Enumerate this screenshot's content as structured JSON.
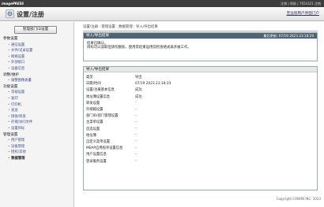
{
  "topbar": {
    "brand": "imagePRESS",
    "meta": "注销 | 帮助 | 7654321 注销"
  },
  "header": {
    "title": "设置/注册",
    "portal": "至远程用户界面门户"
  },
  "sidebar": {
    "button": "管理部门ID设置",
    "nav": [
      {
        "label": "参数设置",
        "type": "cat"
      },
      {
        "label": "通信设置",
        "type": "item"
      },
      {
        "label": "文件/记录设置",
        "type": "item"
      },
      {
        "label": "网络设置",
        "type": "item"
      },
      {
        "label": "外部接口",
        "type": "item"
      },
      {
        "label": "设备信息",
        "type": "item"
      },
      {
        "label": "调整/维护",
        "type": "cat"
      },
      {
        "label": "调整图像质量",
        "type": "item"
      },
      {
        "label": "功能设置",
        "type": "cat"
      },
      {
        "label": "常规设置",
        "type": "item"
      },
      {
        "label": "复印",
        "type": "item"
      },
      {
        "label": "打印机",
        "type": "item"
      },
      {
        "label": "发送",
        "type": "item"
      },
      {
        "label": "接收/转发",
        "type": "item"
      },
      {
        "label": "存储/访问文件",
        "type": "item"
      },
      {
        "label": "设置目标",
        "type": "item"
      },
      {
        "label": "管理设置",
        "type": "cat"
      },
      {
        "label": "用户管理",
        "type": "item"
      },
      {
        "label": "设备管理",
        "type": "item"
      },
      {
        "label": "授权/其他",
        "type": "item"
      },
      {
        "label": "数据管理",
        "type": "item",
        "active": true
      }
    ]
  },
  "main": {
    "breadcrumb": "设置/注册 : 管理设置 : 数据管理 : 导入/导出结果",
    "result_panel": {
      "title": "导入/导出结果",
      "right": "最后更新: 07/19 2023 23:18:29",
      "line1": "结果已确认。",
      "line2": "目标可以读取但请勿删除。使用其结果运用前检查格式再开展工作。"
    },
    "list_panel": {
      "title": "导入/导出结果",
      "rows": [
        {
          "label": "类型",
          "value": "导出"
        },
        {
          "label": "日期/时间",
          "value": "07/19 2023 23:18:23"
        },
        {
          "label": "设置/注册基本信息",
          "value": "成功"
        },
        {
          "label": "地址簿设置信息",
          "value": "成功"
        },
        {
          "label": "转发设置",
          "value": "-"
        },
        {
          "label": "存储箱设置",
          "value": "-"
        },
        {
          "label": "部门ID/部门管理设置",
          "value": "-"
        },
        {
          "label": "主菜单设置",
          "value": "-"
        },
        {
          "label": "首选设置",
          "value": "-"
        },
        {
          "label": "地址簿",
          "value": "-"
        },
        {
          "label": "自定义菜单设置",
          "value": "-"
        },
        {
          "label": "MEAP应用程序设置信息",
          "value": "-"
        },
        {
          "label": "用户设置信息",
          "value": "-"
        },
        {
          "label": "登录服务设置",
          "value": "-"
        }
      ]
    },
    "copyright": "Copyright CANON INC. 2023"
  }
}
